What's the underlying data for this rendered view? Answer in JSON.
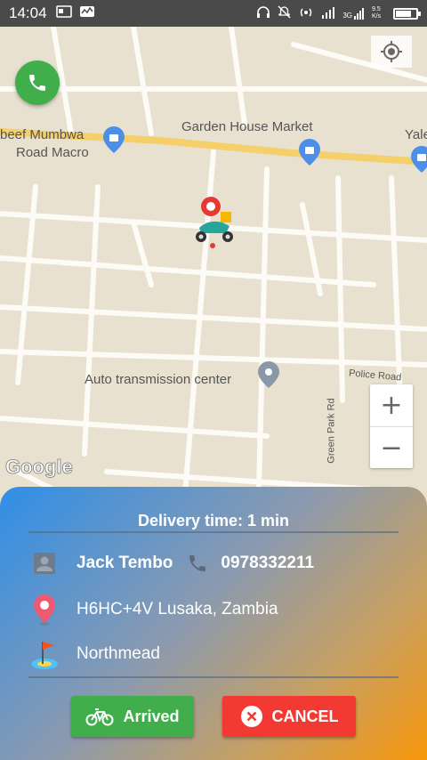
{
  "status_bar": {
    "time": "14:04",
    "network": "3G",
    "speed": "9.5 K/s"
  },
  "map": {
    "labels": [
      "beef Mumbwa",
      "Road Macro",
      "Garden House Market",
      "Yale",
      "Auto transmission center",
      "Police Road",
      "Green Park Rd"
    ],
    "attribution": "Google",
    "zoom_in": "+",
    "zoom_out": "−"
  },
  "delivery": {
    "title": "Delivery time: 1 min",
    "customer_name": "Jack Tembo",
    "customer_phone": "0978332211",
    "address": "H6HC+4V Lusaka, Zambia",
    "destination": "Northmead"
  },
  "actions": {
    "arrived": "Arrived",
    "cancel": "CANCEL"
  },
  "colors": {
    "call_green": "#3fae4b",
    "cancel_red": "#f23a32",
    "highway_yellow": "#f5cf6a"
  }
}
